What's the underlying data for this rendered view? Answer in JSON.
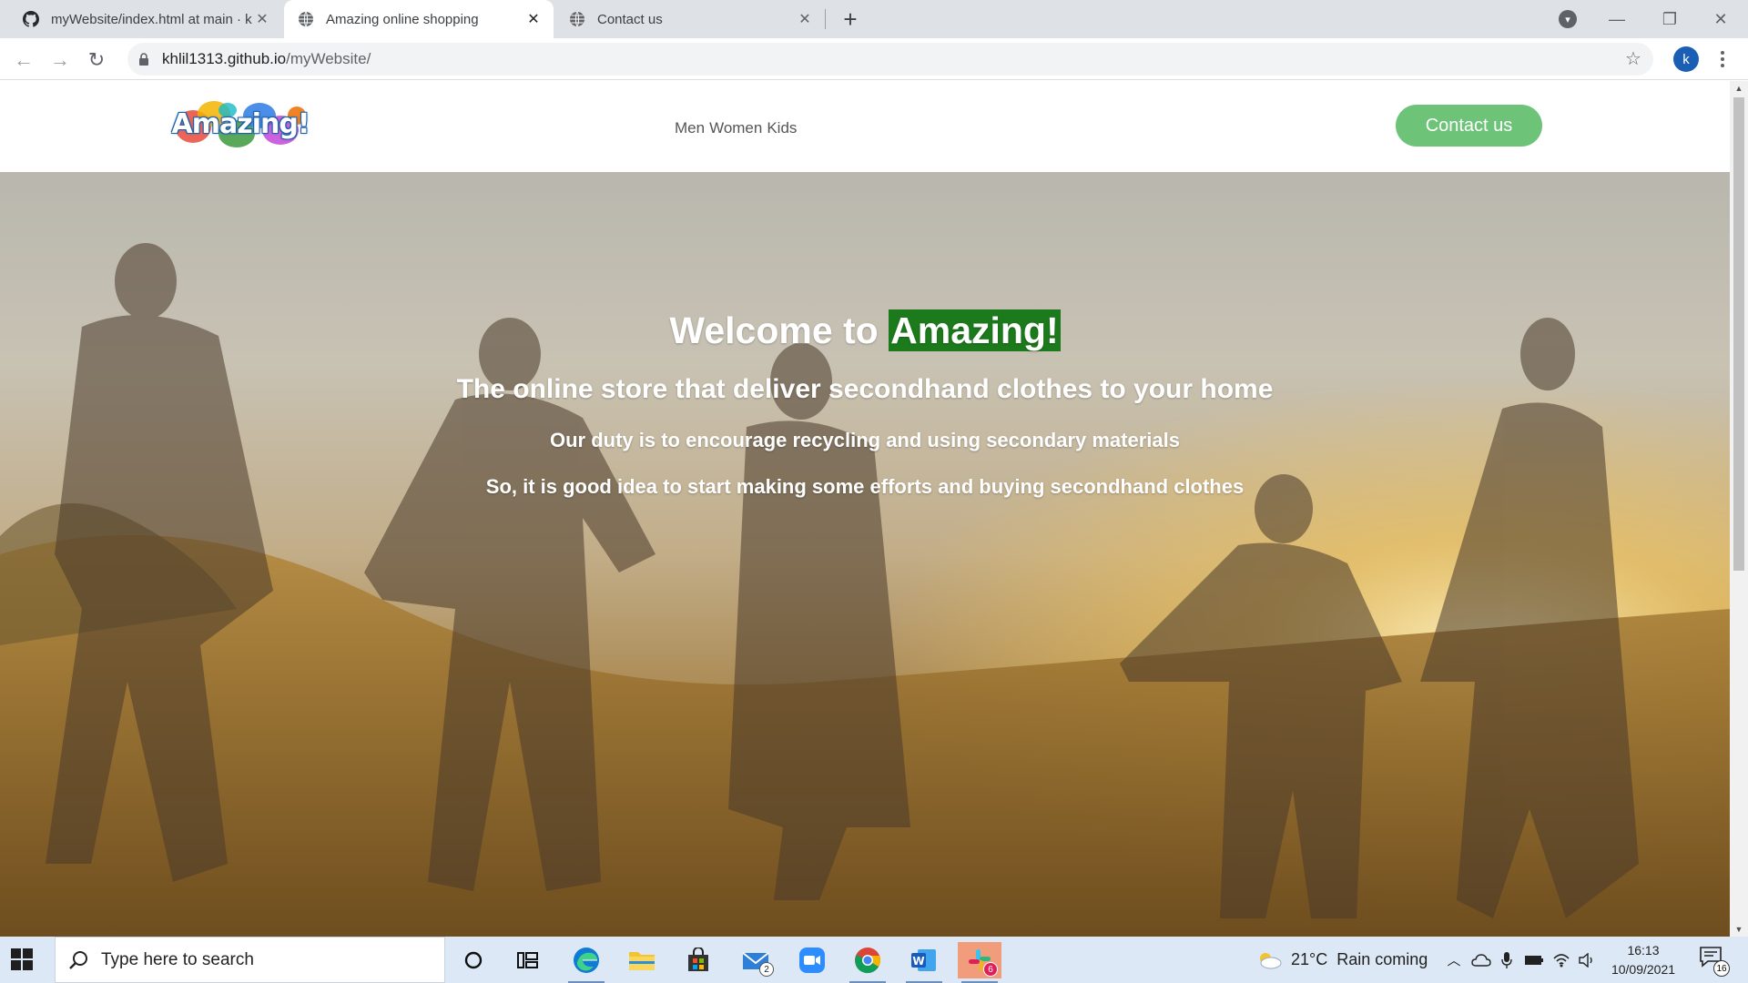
{
  "browser": {
    "tabs": [
      {
        "title": "myWebsite/index.html at main · k",
        "icon": "github-icon",
        "active": false
      },
      {
        "title": "Amazing online shopping",
        "icon": "globe-icon",
        "active": true
      },
      {
        "title": "Contact us",
        "icon": "globe-icon",
        "active": false
      }
    ],
    "url_host": "khlil1313.github.io",
    "url_path": "/myWebsite/",
    "profile_initial": "k"
  },
  "site": {
    "logo_text": "Amazing!",
    "nav": [
      "Men",
      "Women",
      "Kids"
    ],
    "contact_label": "Contact us",
    "hero": {
      "heading_prefix": "Welcome to ",
      "heading_highlight": "Amazing!",
      "subtitle": "The online store that deliver secondhand clothes to your home",
      "line1": "Our duty is to encourage recycling and using secondary materials",
      "line2": "So, it is good idea to start making some efforts and buying secondhand clothes"
    }
  },
  "taskbar": {
    "search_placeholder": "Type here to search",
    "apps": [
      {
        "name": "cortana-icon",
        "badge": ""
      },
      {
        "name": "task-view-icon",
        "badge": ""
      },
      {
        "name": "edge-icon",
        "badge": ""
      },
      {
        "name": "file-explorer-icon",
        "badge": ""
      },
      {
        "name": "store-icon",
        "badge": ""
      },
      {
        "name": "mail-icon",
        "badge": "2"
      },
      {
        "name": "zoom-icon",
        "badge": ""
      },
      {
        "name": "chrome-icon",
        "badge": ""
      },
      {
        "name": "word-icon",
        "badge": ""
      },
      {
        "name": "slack-icon",
        "badge": "6"
      }
    ],
    "weather_temp": "21°C",
    "weather_condition": "Rain coming",
    "time": "16:13",
    "date": "10/09/2021",
    "notification_count": "16"
  },
  "colors": {
    "contact_button": "#6dc479",
    "highlight": "#1c7a1c",
    "browser_frame": "#dee1e6"
  }
}
